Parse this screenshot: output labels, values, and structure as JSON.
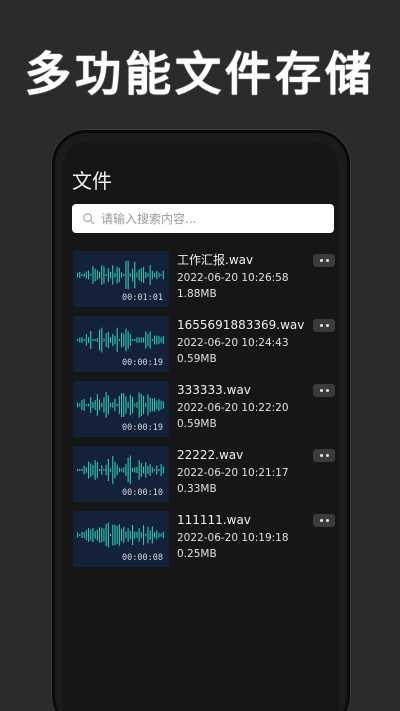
{
  "banner": {
    "title": "多功能文件存储"
  },
  "app": {
    "title": "文件",
    "search": {
      "placeholder": "请输入搜索内容..."
    },
    "files": [
      {
        "name": "工作汇报.wav",
        "timestamp": "2022-06-20 10:26:58",
        "size": "1.88MB",
        "duration": "00:01:01"
      },
      {
        "name": "1655691883369.wav",
        "timestamp": "2022-06-20 10:24:43",
        "size": "0.59MB",
        "duration": "00:00:19"
      },
      {
        "name": "333333.wav",
        "timestamp": "2022-06-20 10:22:20",
        "size": "0.59MB",
        "duration": "00:00:19"
      },
      {
        "name": "22222.wav",
        "timestamp": "2022-06-20 10:21:17",
        "size": "0.33MB",
        "duration": "00:00:10"
      },
      {
        "name": "111111.wav",
        "timestamp": "2022-06-20 10:19:18",
        "size": "0.25MB",
        "duration": "00:00:08"
      }
    ],
    "icons": {
      "search": "search-icon",
      "more": "more-icon",
      "waveform": "waveform-icon"
    },
    "colors": {
      "accent": "#2bd3a7",
      "waveform": "#2fc6b4",
      "thumb_bg": "#13223a",
      "background": "#161616"
    }
  }
}
